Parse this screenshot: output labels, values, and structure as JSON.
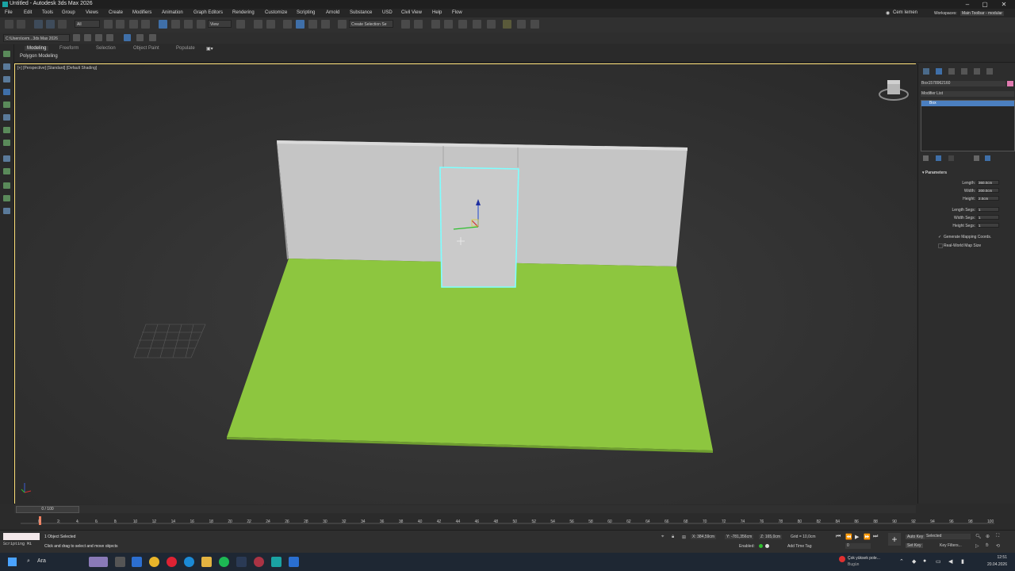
{
  "titlebar": {
    "title": "Untitled - Autodesk 3ds Max 2026",
    "min": "–",
    "max": "▢",
    "close": "✕"
  },
  "menu": [
    "File",
    "Edit",
    "Tools",
    "Group",
    "Views",
    "Create",
    "Modifiers",
    "Animation",
    "Graph Editors",
    "Rendering",
    "Customize",
    "Scripting",
    "Arnold",
    "Substance",
    "USD",
    "Civil View",
    "Help",
    "Flow"
  ],
  "user": {
    "name": "Cem Iemen",
    "workspaces_label": "Workspaces:",
    "workspace": "Main Toolbar - modular"
  },
  "toolbar": {
    "filter": "All",
    "view": "View",
    "selection_set": "Create Selection Se",
    "path": "C:\\Users\\cem...3ds Max 2026"
  },
  "ribbon": {
    "tabs": [
      "Modeling",
      "Freeform",
      "Selection",
      "Object Paint",
      "Populate"
    ],
    "subtab": "Polygon Modeling"
  },
  "viewport": {
    "label": "[+] [Perspective] [Standard] [Default Shading]"
  },
  "command_panel": {
    "object_name": "Box1578962160",
    "modifier_list": "Modifier List",
    "stack_item": "Box",
    "rollout": "Parameters",
    "params": [
      {
        "label": "Length:",
        "value": "360,0cm"
      },
      {
        "label": "Width:",
        "value": "200,0cm"
      },
      {
        "label": "Height:",
        "value": "2,0cm"
      },
      {
        "label": "Length Segs:",
        "value": "1"
      },
      {
        "label": "Width Segs:",
        "value": "1"
      },
      {
        "label": "Height Segs:",
        "value": "1"
      }
    ],
    "gen_mapping": "Generate Mapping Coords.",
    "real_world": "Real-World Map Size"
  },
  "timeline": {
    "frame": "0 / 100",
    "ticks": [
      "0",
      "2",
      "4",
      "6",
      "8",
      "10",
      "12",
      "14",
      "16",
      "18",
      "20",
      "22",
      "24",
      "26",
      "28",
      "30",
      "32",
      "34",
      "36",
      "38",
      "40",
      "42",
      "44",
      "46",
      "48",
      "50",
      "52",
      "54",
      "56",
      "58",
      "60",
      "62",
      "64",
      "66",
      "68",
      "70",
      "72",
      "74",
      "76",
      "78",
      "80",
      "82",
      "84",
      "86",
      "88",
      "90",
      "92",
      "94",
      "96",
      "98",
      "100"
    ]
  },
  "status": {
    "selected": "1 Object Selected",
    "prompt": "Click and drag to select and move objects",
    "script_label": "Scripting Mi",
    "x": "X: 384,59cm",
    "y": "Y: -781,356cm",
    "z": "Z: 165,0cm",
    "grid": "Grid = 10,0cm",
    "enabled": "Enabled:",
    "add_time_tag": "Add Time Tag",
    "auto_key": "Auto Key",
    "set_key": "Set Key",
    "selected_dd": "Selected",
    "key_filters": "Key Filters...",
    "frame_field": "0"
  },
  "taskbar": {
    "search": "Ara",
    "notif_title": "Çok yüksek pole...",
    "notif_sub": "Bugün",
    "time": "12:51",
    "date": "20.04.2026"
  },
  "colors": {
    "selection": "#7fffff",
    "ground": "#8dc63f",
    "wall": "#c8c8c8",
    "viewport_border": "#ffe27a"
  }
}
